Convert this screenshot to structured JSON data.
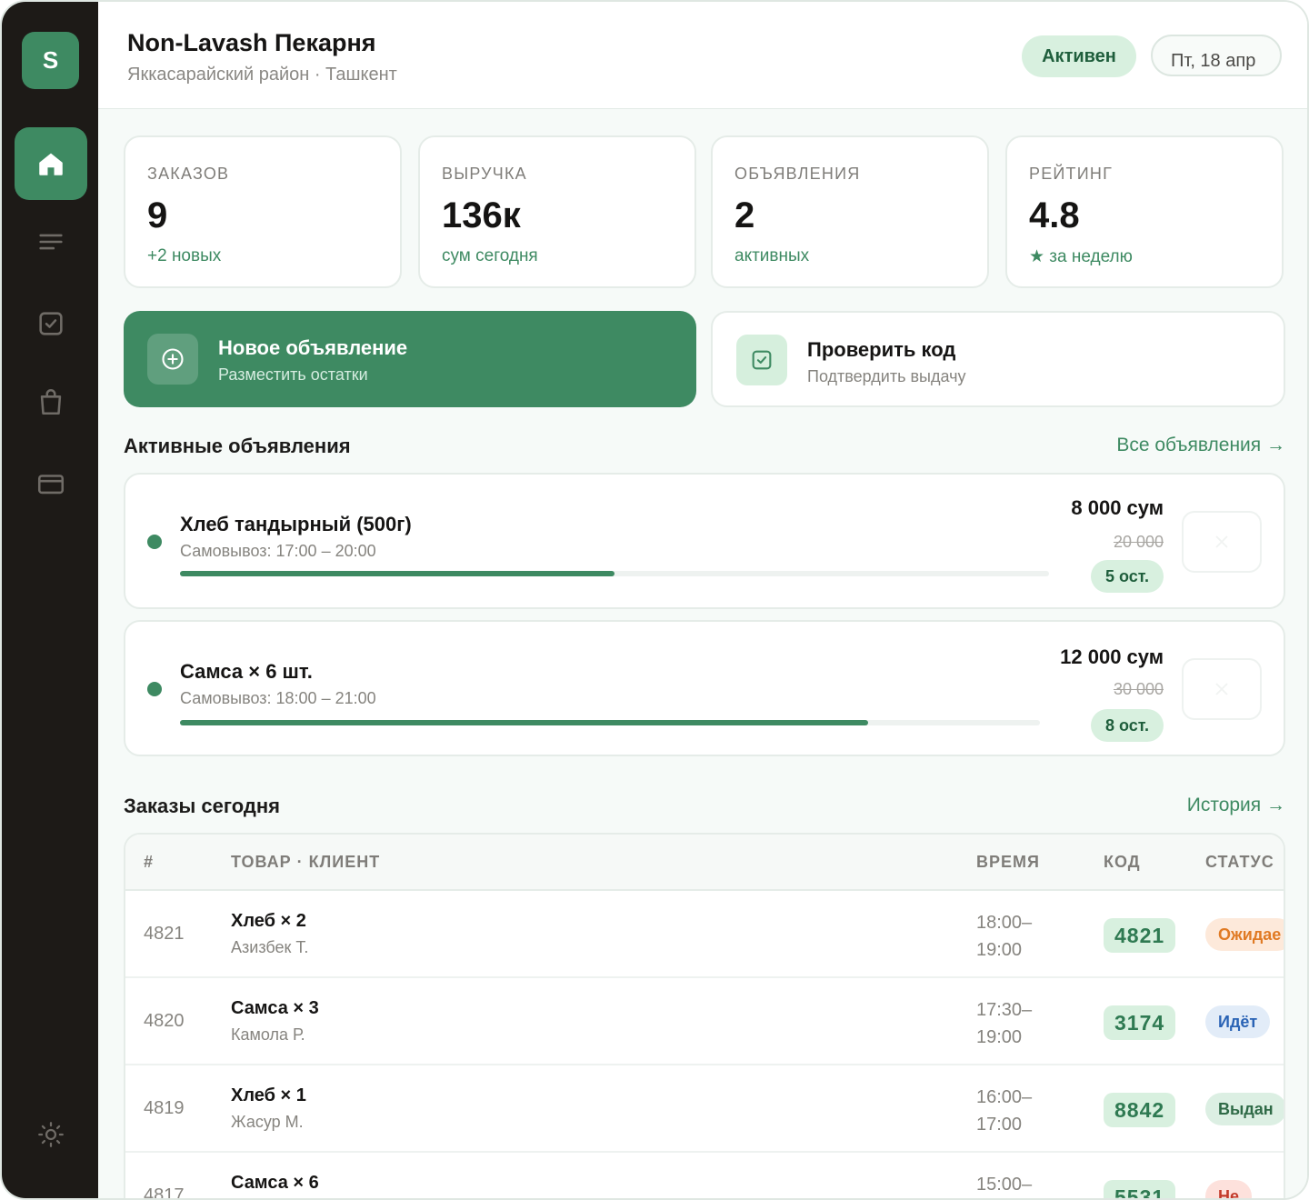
{
  "sidebar": {
    "logo_letter": "S",
    "items": [
      {
        "name": "home-icon",
        "active": true
      },
      {
        "name": "list-icon",
        "active": false
      },
      {
        "name": "checkbox-icon",
        "active": false
      },
      {
        "name": "shopping-bag-icon",
        "active": false
      },
      {
        "name": "card-icon",
        "active": false
      }
    ],
    "settings_icon": "sun-icon"
  },
  "header": {
    "title": "Non-Lavash Пекарня",
    "subtitle": "Яккасарайский район · Ташкент",
    "status": "Активен",
    "date": "Пт, 18 апр"
  },
  "stats": [
    {
      "label": "ЗАКАЗОВ",
      "value": "9",
      "sub": "+2 новых"
    },
    {
      "label": "ВЫРУЧКА",
      "value": "136к",
      "sub": "сум сегодня"
    },
    {
      "label": "ОБЪЯВЛЕНИЯ",
      "value": "2",
      "sub": "активных"
    },
    {
      "label": "РЕЙТИНГ",
      "value": "4.8",
      "sub": "★ за неделю"
    }
  ],
  "actions": {
    "new_listing": {
      "title": "Новое объявление",
      "subtitle": "Разместить остатки"
    },
    "check_code": {
      "title": "Проверить код",
      "subtitle": "Подтвердить выдачу"
    }
  },
  "listings_section": {
    "title": "Активные объявления",
    "link": "Все объявления →",
    "items": [
      {
        "name": "Хлеб тандырный (500г)",
        "pickup": "Самовывоз: 17:00 – 20:00",
        "price": "8 000 сум",
        "old_price": "20 000",
        "left": "5 ост.",
        "progress": 0.5
      },
      {
        "name": "Самса × 6 шт.",
        "pickup": "Самовывоз: 18:00 – 21:00",
        "price": "12 000 сум",
        "old_price": "30 000",
        "left": "8 ост.",
        "progress": 0.8
      }
    ]
  },
  "orders_section": {
    "title": "Заказы сегодня",
    "link": "История →",
    "columns": [
      "#",
      "ТОВАР · КЛИЕНТ",
      "ВРЕМЯ",
      "КОД",
      "СТАТУС"
    ],
    "rows": [
      {
        "id": "4821",
        "item": "Хлеб × 2",
        "client": "Азизбек Т.",
        "time": "18:00–19:00",
        "code": "4821",
        "status": "Ожидае",
        "status_kind": "orange"
      },
      {
        "id": "4820",
        "item": "Самса × 3",
        "client": "Камола Р.",
        "time": "17:30–19:00",
        "code": "3174",
        "status": "Идёт",
        "status_kind": "blue"
      },
      {
        "id": "4819",
        "item": "Хлеб × 1",
        "client": "Жасур М.",
        "time": "16:00–17:00",
        "code": "8842",
        "status": "Выдан",
        "status_kind": "green"
      },
      {
        "id": "4817",
        "item": "Самса × 6",
        "client": "",
        "time": "15:00–",
        "code": "5531",
        "status": "Не",
        "status_kind": "red"
      }
    ]
  },
  "colors": {
    "accent": "#3e8a62",
    "sidebar": "#1d1a17",
    "badge_bg": "#d8f0df"
  }
}
